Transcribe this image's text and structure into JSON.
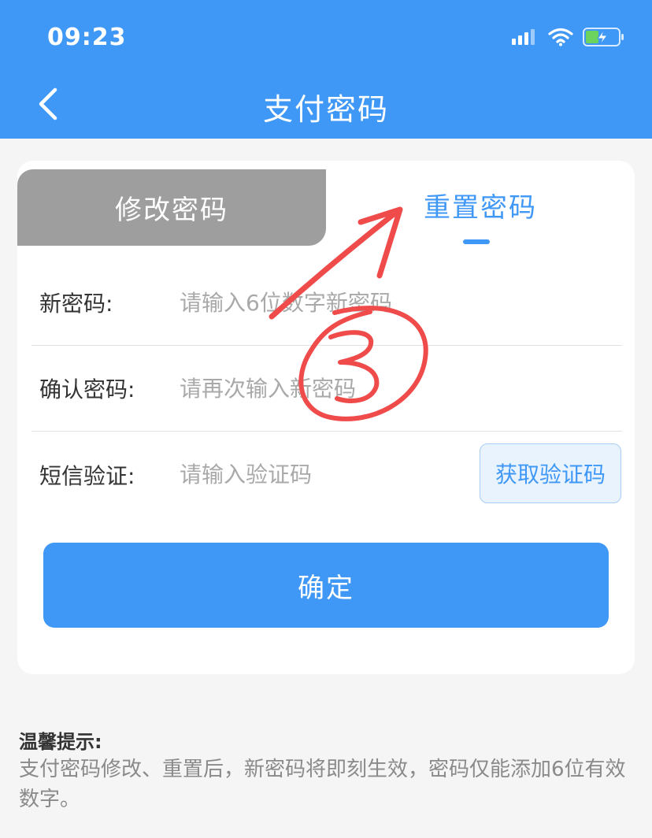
{
  "status_bar": {
    "time": "09:23"
  },
  "header": {
    "title": "支付密码",
    "back_icon": "chevron-left-icon"
  },
  "tabs": {
    "inactive_label": "修改密码",
    "active_label": "重置密码"
  },
  "form": {
    "new_password": {
      "label": "新密码:",
      "placeholder": "请输入6位数字新密码"
    },
    "confirm_password": {
      "label": "确认密码:",
      "placeholder": "请再次输入新密码"
    },
    "sms": {
      "label": "短信验证:",
      "placeholder": "请输入验证码",
      "button": "获取验证码"
    }
  },
  "confirm_button": "确定",
  "tips": {
    "title": "温馨提示:",
    "body": "支付密码修改、重置后，新密码将即刻生效，密码仅能添加6位有效数字。"
  },
  "colors": {
    "primary": "#3f97f6",
    "inactive_tab": "#9e9e9e",
    "annotation": "#ef4b4b"
  }
}
